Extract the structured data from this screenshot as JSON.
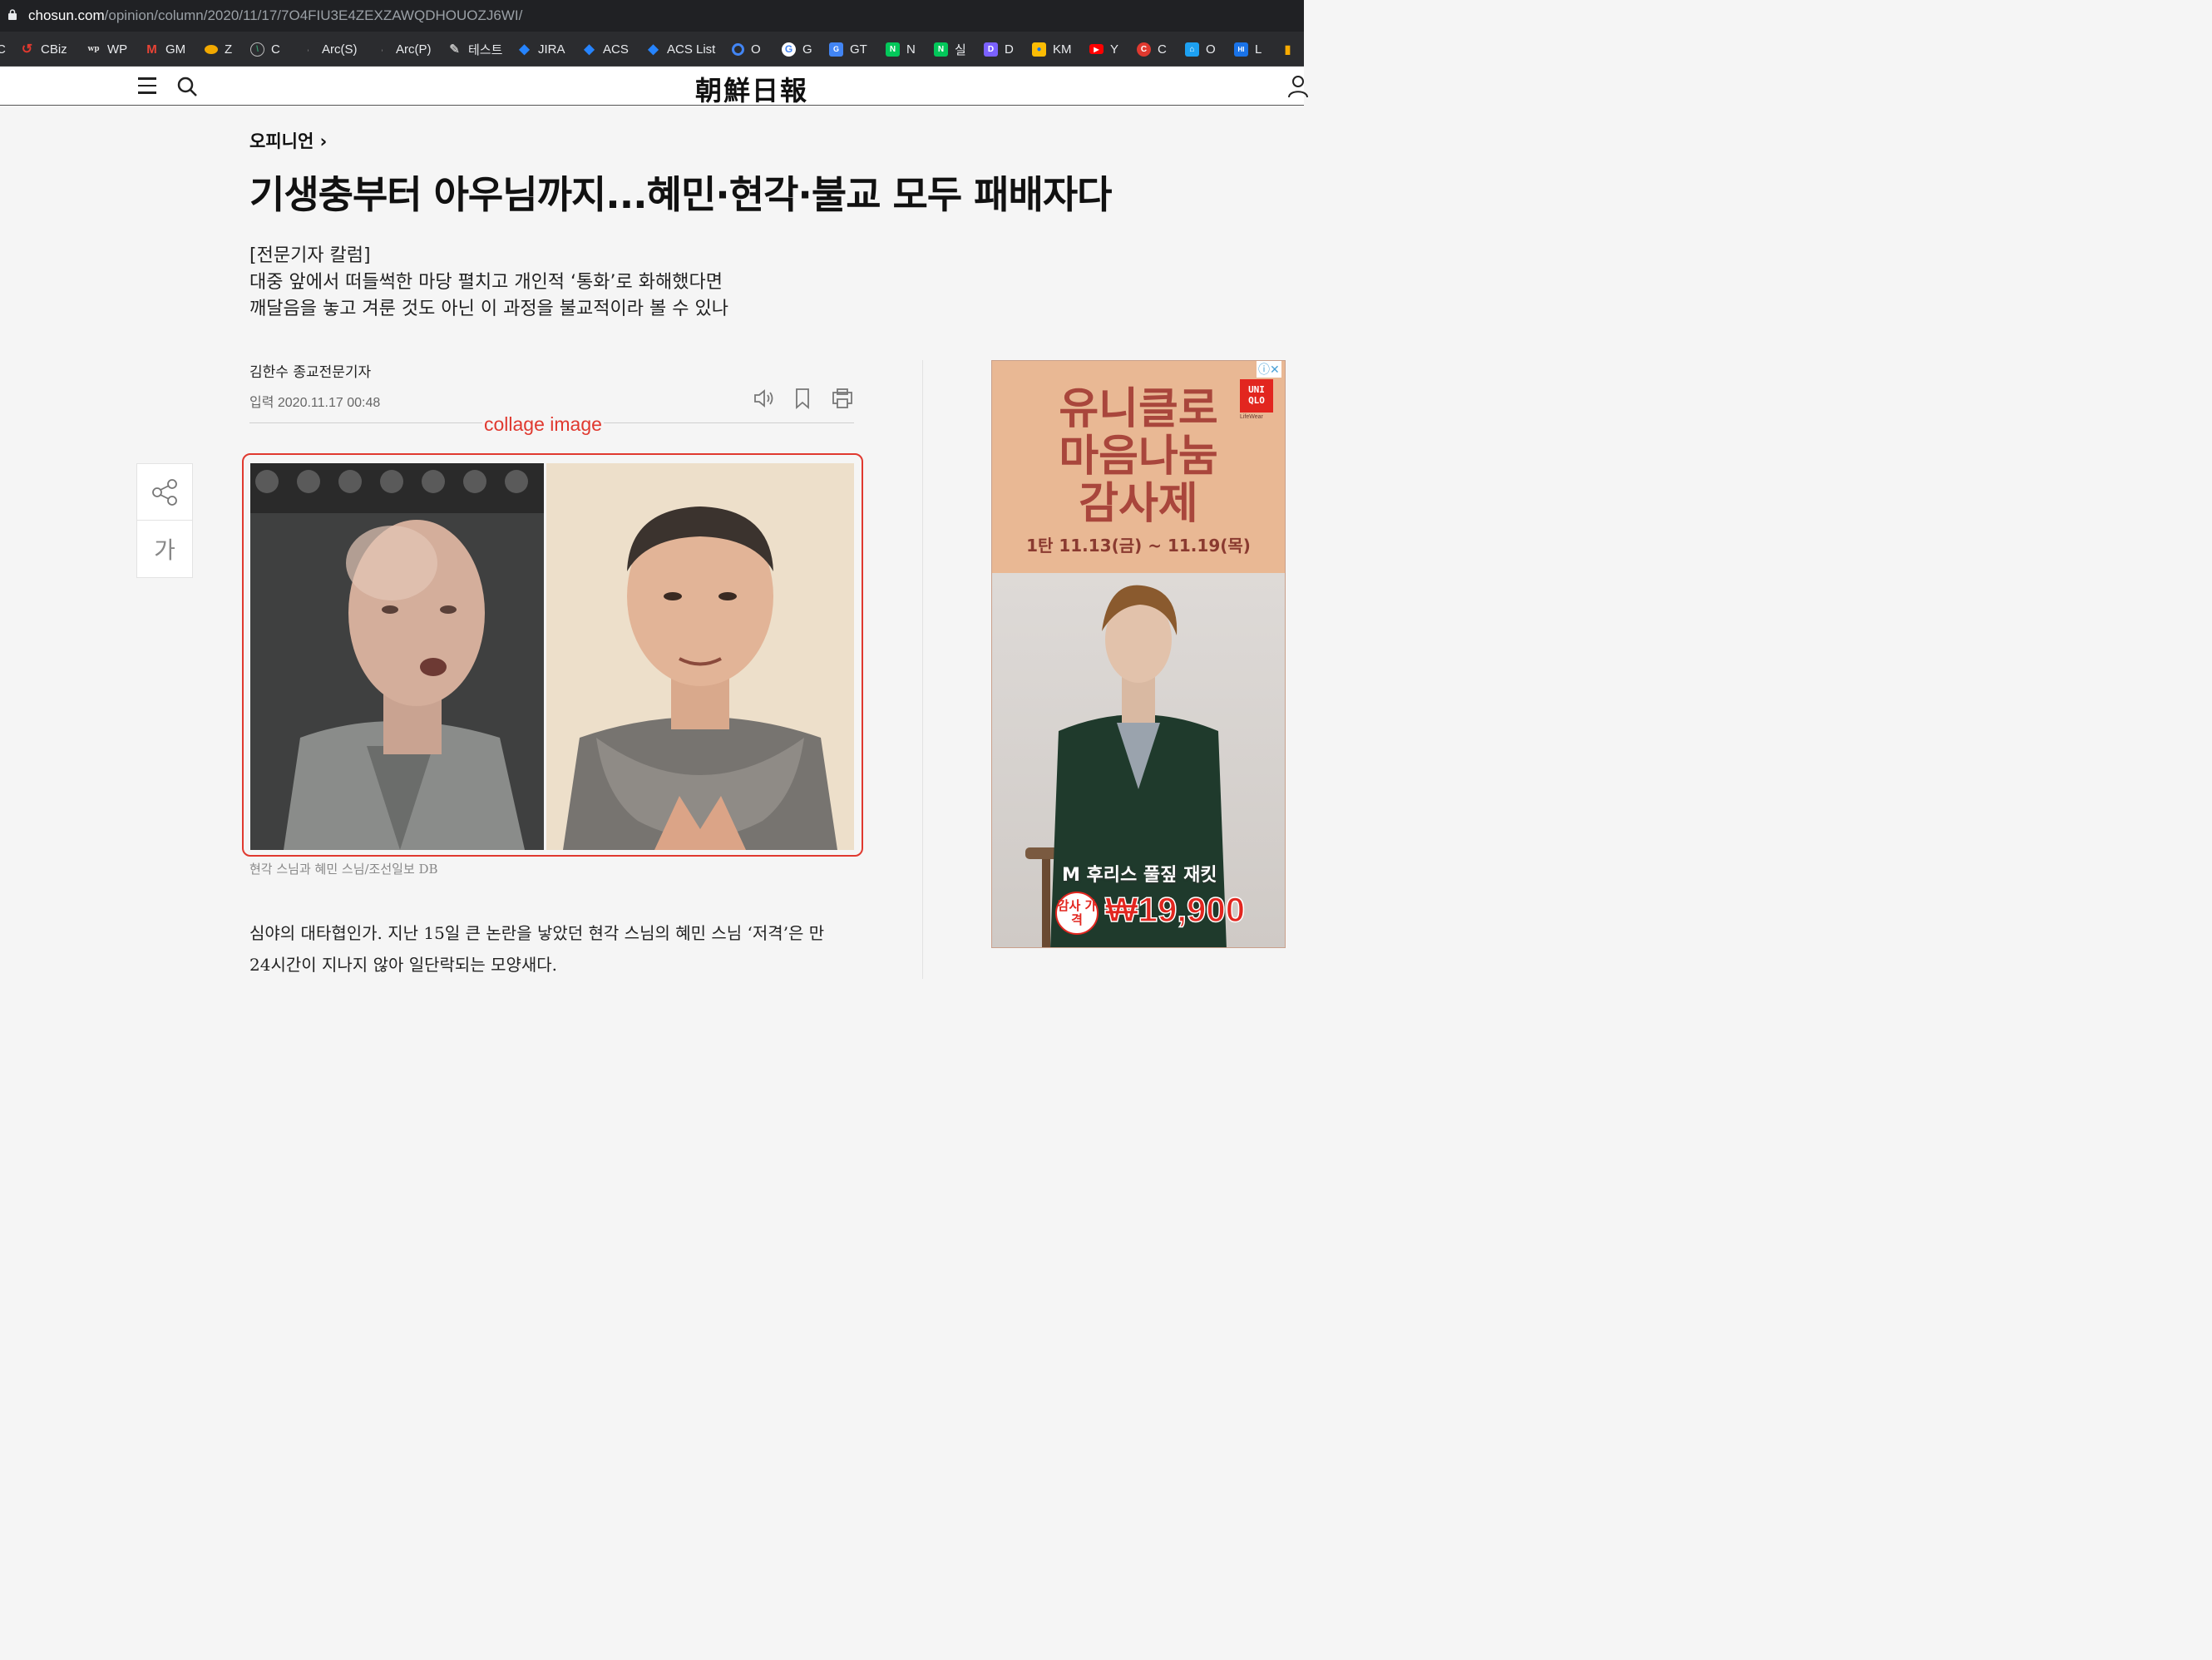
{
  "browser": {
    "url_host": "chosun.com",
    "url_path": "/opinion/column/2020/11/17/7O4FIU3E4ZEXZAWQDHOUOZJ6WI/"
  },
  "bookmarks": [
    {
      "label": "C"
    },
    {
      "label": "CBiz",
      "color": "#e0392f"
    },
    {
      "label": "WP",
      "color": "#111111"
    },
    {
      "label": "GM",
      "color": "#ea4335"
    },
    {
      "label": "Z",
      "color": "#f2a900"
    },
    {
      "label": "C",
      "color": "#3a9b6e"
    },
    {
      "label": "Arc(S)"
    },
    {
      "label": "Arc(P)"
    },
    {
      "label": "테스트"
    },
    {
      "label": "JIRA",
      "color": "#2684ff"
    },
    {
      "label": "ACS",
      "color": "#2684ff"
    },
    {
      "label": "ACS List",
      "color": "#2684ff"
    },
    {
      "label": "O",
      "color": "#4285f4"
    },
    {
      "label": "G",
      "color": "#ffffff"
    },
    {
      "label": "GT",
      "color": "#4285f4"
    },
    {
      "label": "N",
      "color": "#03c75a"
    },
    {
      "label": "실",
      "color": "#03c75a"
    },
    {
      "label": "D",
      "color": "#7b61ff"
    },
    {
      "label": "KM",
      "color": "#fbbc04"
    },
    {
      "label": "Y",
      "color": "#ff0000"
    },
    {
      "label": "C",
      "color": "#e0392f"
    },
    {
      "label": "O",
      "color": "#1da1f2"
    },
    {
      "label": "L",
      "color": "#1a73e8"
    }
  ],
  "site": {
    "logo": "朝鮮日報"
  },
  "article": {
    "section": "오피니언",
    "headline": "기생충부터 아우님까지...혜민·현각·불교 모두 패배자다",
    "subhead": [
      "[전문기자 칼럼]",
      "대중 앞에서 떠들썩한 마당 펼치고 개인적 ‘통화’로 화해했다면",
      "깨달음을 놓고 겨룬 것도 아닌 이 과정을 불교적이라 볼 수 있나"
    ],
    "byline": "김한수 종교전문기자",
    "date": "입력 2020.11.17 00:48",
    "annotation": "collage image",
    "caption": "현각 스님과 혜민 스님/조선일보 DB",
    "body": [
      "심야의 대타협인가. 지난 15일 큰 논란을 낳았던 현각 스님의 혜민 스님 ‘저격’은 만",
      "24시간이 지나지 않아 일단락되는 모양새다."
    ],
    "font_button": "가"
  },
  "ad": {
    "title": [
      "유니클로",
      "마음나눔",
      "감사제"
    ],
    "date": "1탄 11.13(금) ~ 11.19(목)",
    "logo": "UNI QLO",
    "logo_sub": "LifeWear",
    "product": "M 후리스 풀짚 재킷",
    "badge": "감사 가격",
    "price": "₩19,900",
    "close": "ⓘ✕"
  },
  "colors": {
    "accent_annotation": "#e0392f",
    "ad_bg": "#e9b894",
    "ad_text": "#a9463c"
  }
}
